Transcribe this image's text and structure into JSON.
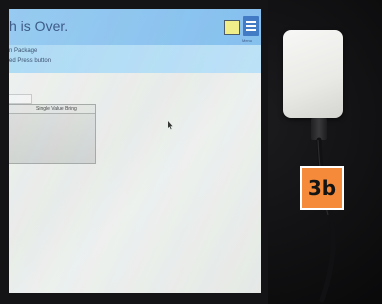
{
  "app": {
    "title": "h is Over.",
    "menu_caption": "Menu"
  },
  "subheader": {
    "line1": "n Package",
    "line2": "ed Press button"
  },
  "panel": {
    "label": "Single Value Bring"
  },
  "figure_label": "3b",
  "colors": {
    "header_blue": "#8ec7f0",
    "band_blue": "#a9d9f5",
    "menu_blue": "#2f6fc0",
    "indicator_yellow": "#f4ef7a",
    "label_orange": "#f48a3a",
    "device_white": "#f0f0ed"
  },
  "icons": {
    "menu": "hamburger-menu-icon",
    "cursor": "mouse-cursor-icon"
  }
}
